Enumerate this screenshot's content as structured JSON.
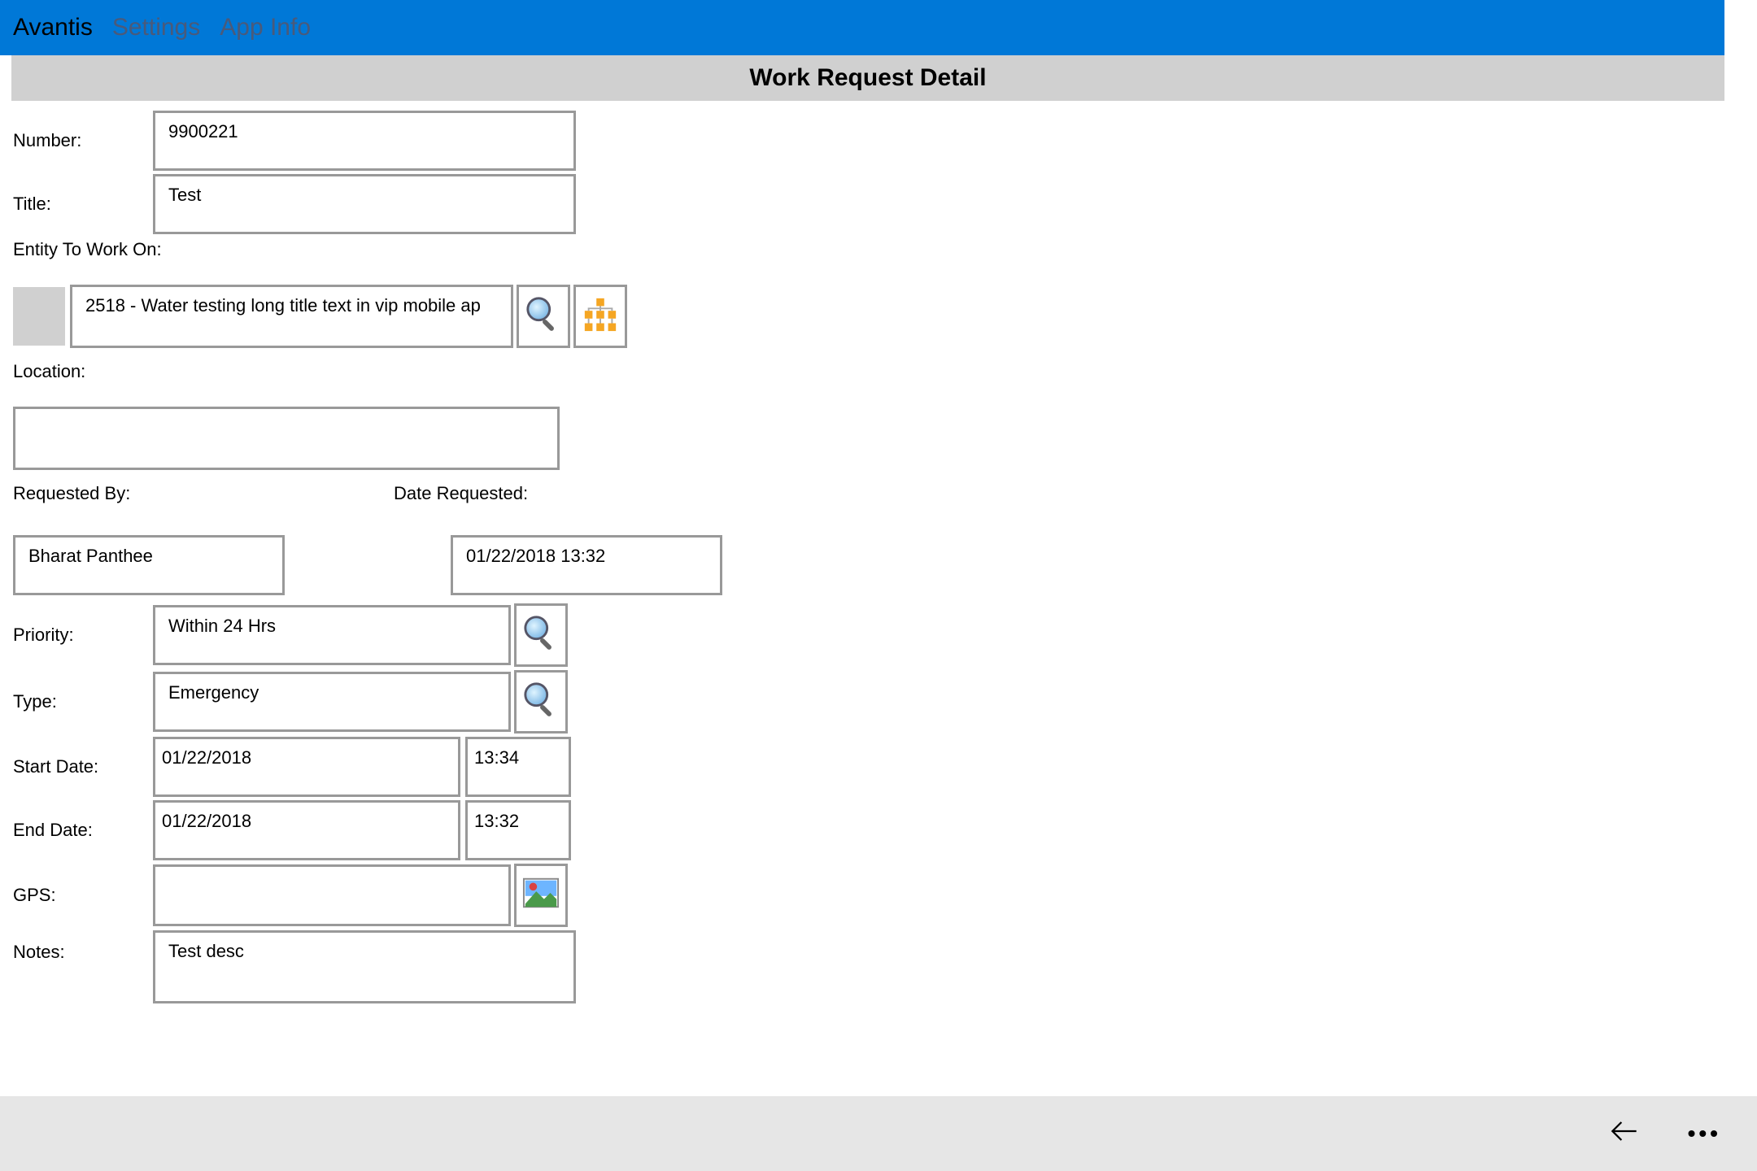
{
  "topnav": {
    "items": [
      "Avantis",
      "Settings",
      "App Info"
    ],
    "active_index": 0
  },
  "section_title": "Work Request Detail",
  "labels": {
    "number": "Number:",
    "title": "Title:",
    "entity": "Entity To Work On:",
    "location": "Location:",
    "requested_by": "Requested By:",
    "date_requested": "Date Requested:",
    "priority": "Priority:",
    "type": "Type:",
    "start_date": "Start Date:",
    "end_date": "End Date:",
    "gps": "GPS:",
    "notes": "Notes:"
  },
  "values": {
    "number": "9900221",
    "title": "Test",
    "entity": "2518 - Water testing long title text in vip mobile ap",
    "location": "",
    "requested_by": "Bharat Panthee",
    "date_requested": "01/22/2018 13:32",
    "priority": "Within 24 Hrs",
    "type": "Emergency",
    "start_date": "01/22/2018",
    "start_time": "13:34",
    "end_date": "01/22/2018",
    "end_time": "13:32",
    "gps": "",
    "notes": "Test desc"
  }
}
